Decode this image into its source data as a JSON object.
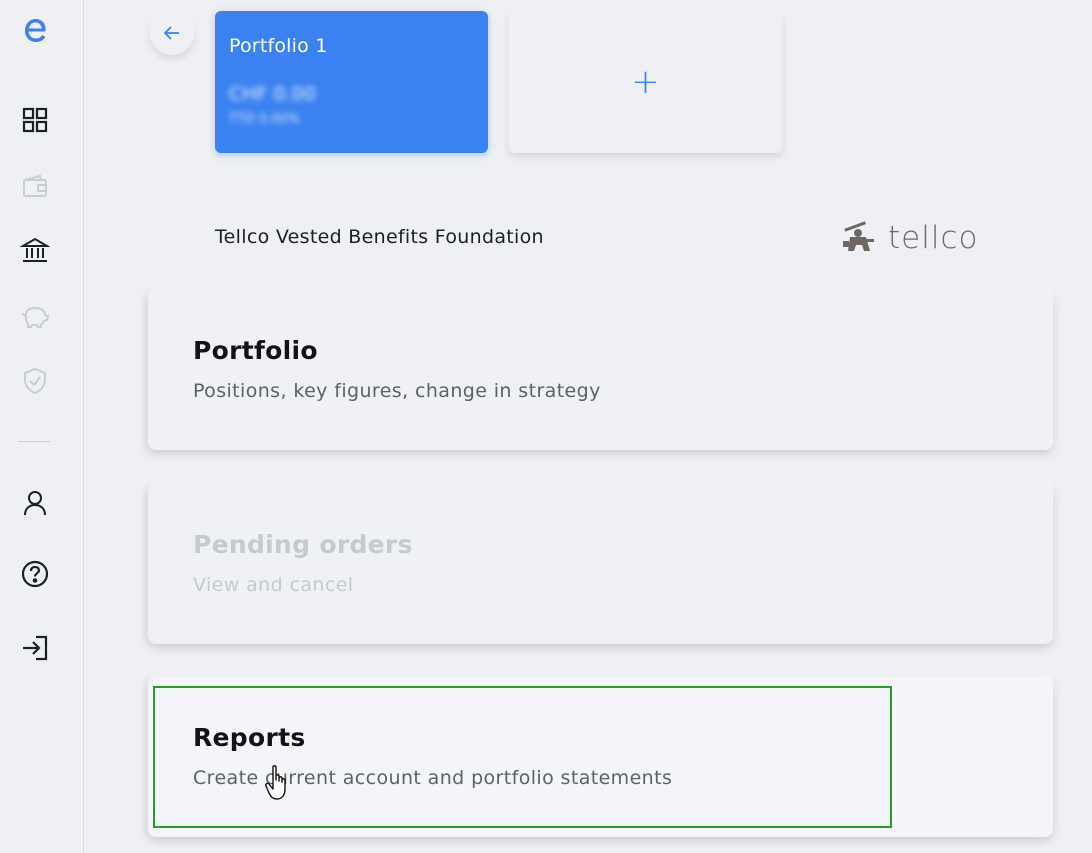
{
  "sidebar": {
    "logo": "e",
    "items": [
      {
        "icon": "grid-icon",
        "state": "active"
      },
      {
        "icon": "wallet-icon",
        "state": "disabled"
      },
      {
        "icon": "bank-icon",
        "state": "active"
      },
      {
        "icon": "piggy-bank-icon",
        "state": "disabled"
      },
      {
        "icon": "shield-check-icon",
        "state": "disabled"
      },
      {
        "icon": "user-icon",
        "state": "active"
      },
      {
        "icon": "help-icon",
        "state": "active"
      },
      {
        "icon": "login-icon",
        "state": "active"
      }
    ]
  },
  "portfolio_card": {
    "title": "Portfolio 1",
    "amount": "CHF 0.00",
    "sub": "TTD 0.00%"
  },
  "add_card": {
    "label": "+"
  },
  "foundation": {
    "name": "Tellco Vested Benefits Foundation",
    "logo_text": "tellco"
  },
  "menu": [
    {
      "title": "Portfolio",
      "subtitle": "Positions, key figures, change in strategy",
      "state": "enabled"
    },
    {
      "title": "Pending orders",
      "subtitle": "View and cancel",
      "state": "disabled"
    },
    {
      "title": "Reports",
      "subtitle": "Create current account and portfolio statements",
      "state": "enabled"
    }
  ],
  "colors": {
    "accent": "#3b82f0",
    "background": "#eef0f4",
    "highlight": "#2f9a2f",
    "disabled_text": "#c6c9ce"
  }
}
